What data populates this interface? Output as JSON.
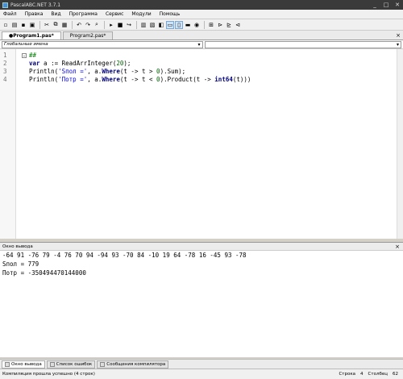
{
  "window": {
    "title": "PascalABC.NET 3.7.1",
    "minimize": "_",
    "maximize": "□",
    "close": "✕"
  },
  "menu": [
    "Файл",
    "Правка",
    "Вид",
    "Программа",
    "Сервис",
    "Модули",
    "Помощь"
  ],
  "tabs": [
    {
      "label": "●Program1.pas*",
      "active": true
    },
    {
      "label": "Program2.pas*",
      "active": false
    }
  ],
  "tab_close": "×",
  "scope": {
    "left": "Глобальные имена",
    "left_arrow": "▾",
    "right_arrow": "▾"
  },
  "editor": {
    "line_numbers": [
      "1",
      "2",
      "3",
      "4"
    ],
    "fold_marker": "-"
  },
  "output": {
    "header": "Окно вывода",
    "close": "×",
    "lines": [
      "-64 91 -76 79 -4 76 70 94 -94 93 -70 84 -10 19 64 -78 16 -45 93 -78",
      "Sпол = 779",
      "Потр = -350494470144000"
    ]
  },
  "bottom_tabs": [
    "Окно вывода",
    "Список ошибок",
    "Сообщения компилятора"
  ],
  "status": {
    "message": "Компиляция прошла успешно (4 строк)",
    "row_label": "Строка",
    "row": "4",
    "col_label": "Столбец",
    "col": "62"
  }
}
